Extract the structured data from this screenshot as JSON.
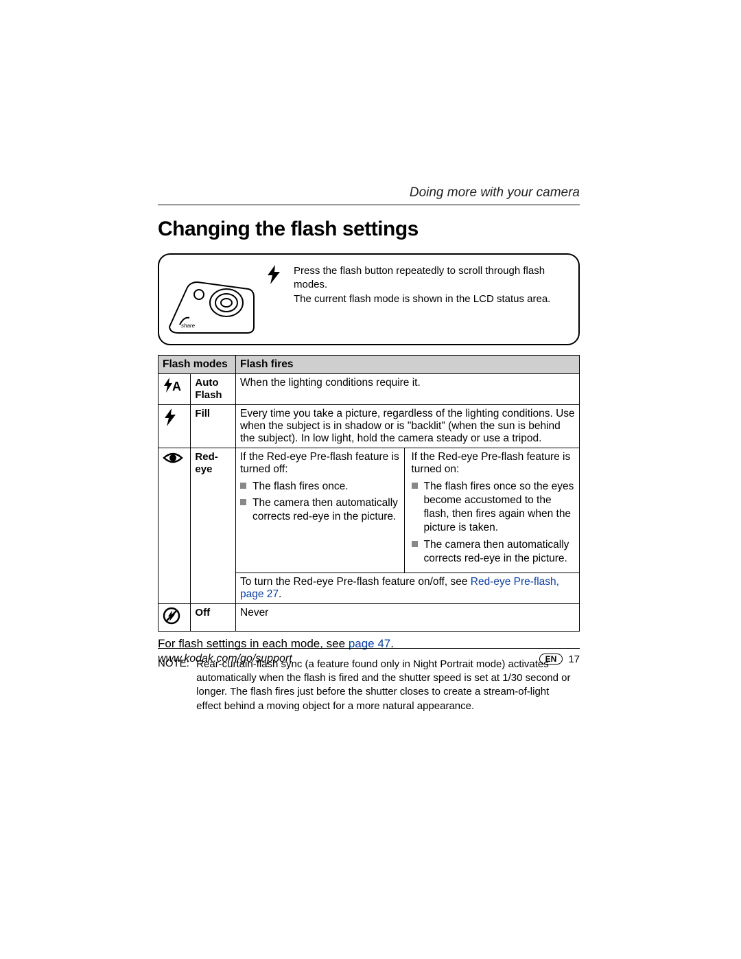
{
  "section_header": "Doing more with your camera",
  "title": "Changing the flash settings",
  "diagram": {
    "line1": "Press the flash button repeatedly to scroll through flash modes.",
    "line2": "The current flash mode is shown in the LCD status area."
  },
  "table": {
    "col1": "Flash modes",
    "col2": "Flash fires",
    "rows": {
      "auto": {
        "label": "Auto Flash",
        "fires": "When the lighting conditions require it."
      },
      "fill": {
        "label": "Fill",
        "fires": "Every time you take a picture, regardless of the lighting conditions. Use when the subject is in shadow or is \"backlit\" (when the sun is behind the subject). In low light, hold the camera steady or use a tripod."
      },
      "redeye": {
        "label": "Red-eye",
        "off_intro": "If the Red-eye Pre-flash feature is turned off:",
        "off_b1": "The flash fires once.",
        "off_b2": "The camera then automatically corrects red-eye in the picture.",
        "on_intro": "If the Red-eye Pre-flash feature is turned on:",
        "on_b1": "The flash fires once so the eyes become accustomed to the flash, then fires again when the picture is taken.",
        "on_b2": "The camera then automatically corrects red-eye in the picture.",
        "toggle_pre": "To turn the Red-eye Pre-flash feature on/off, see ",
        "toggle_link": "Red-eye Pre-flash, page 27",
        "toggle_post": "."
      },
      "off": {
        "label": "Off",
        "fires": "Never"
      }
    }
  },
  "below_table_pre": "For flash settings in each mode, see ",
  "below_table_link": "page 47",
  "below_table_post": ".",
  "note_label": "NOTE:",
  "note_body": "Rear-curtain-flash sync (a feature found only in Night Portrait mode) activates automatically when the flash is fired and the shutter speed is set at 1/30 second or longer. The flash fires just before the shutter closes to create a stream-of-light effect behind a moving object for a more natural appearance.",
  "footer_url": "www.kodak.com/go/support",
  "lang_code": "EN",
  "page_number": "17"
}
